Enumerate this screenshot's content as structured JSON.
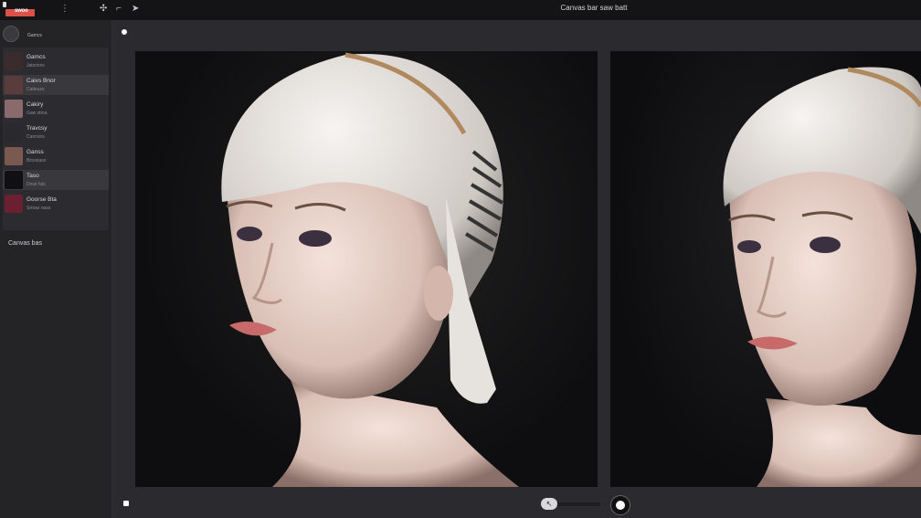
{
  "window": {
    "title": "Canvas bar saw batt"
  },
  "toolbar": {
    "icon_move": "move-icon",
    "icon_crop": "crop-icon",
    "icon_arrow": "arrow-right-icon",
    "move_glyph": "✣",
    "crop_glyph": "⌐",
    "arrow_glyph": "➤"
  },
  "logo": {
    "text": "swoo"
  },
  "sidebar": {
    "header": "Gamcs",
    "items": [
      {
        "label": "Gamcs",
        "sub": "Jatsmins",
        "active": false
      },
      {
        "label": "Caivs Bnor",
        "sub": "Caiteuss",
        "active": true
      },
      {
        "label": "Cakiry",
        "sub": "Gaw stma",
        "active": false
      },
      {
        "label": "Travcsy",
        "sub": "Cannsirs",
        "active": false
      },
      {
        "label": "Ganss",
        "sub": "Bicesiaos",
        "active": false
      },
      {
        "label": "Taso",
        "sub": "Dnsir fuls",
        "active": true
      },
      {
        "label": "Goorse Bta",
        "sub": "Smsar nass",
        "active": false
      }
    ],
    "footer": "Canvas bas"
  },
  "canvas": {
    "slider_icon": "cursor-icon",
    "slider_glyph": "↖",
    "slider_value": 0.28
  },
  "colors": {
    "accent": "#d8524a",
    "bg": "#1c1c1e",
    "panel": "#2c2c30"
  }
}
